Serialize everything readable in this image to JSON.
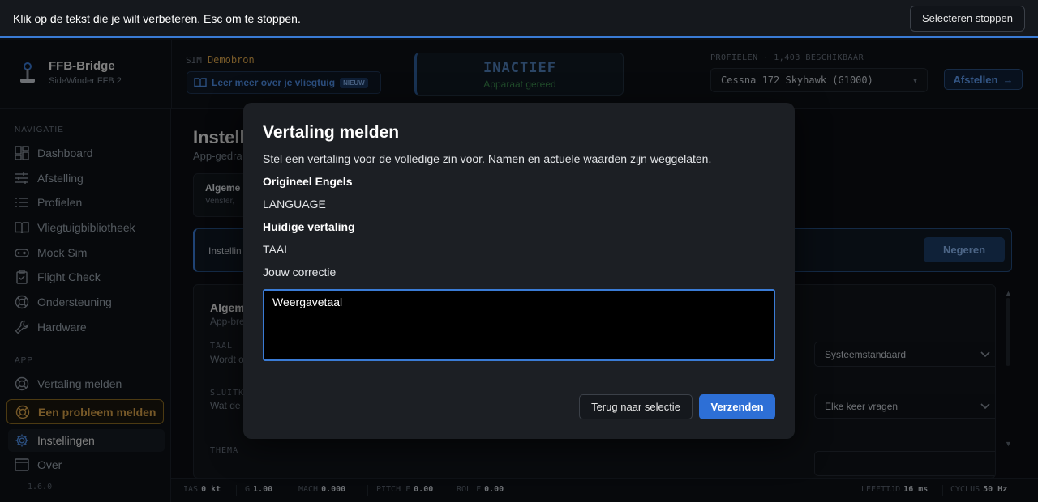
{
  "translate_bar": {
    "message": "Klik op de tekst die je wilt verbeteren. Esc om te stoppen.",
    "stop_label": "Selecteren stoppen"
  },
  "header": {
    "app_name": "FFB-Bridge",
    "device": "SideWinder FFB 2",
    "sim_label": "SIM",
    "sim_value": "Demobron",
    "learn_label": "Leer meer over je vliegtuig",
    "learn_badge": "NIEUW",
    "status_title": "INACTIEF",
    "status_sub": "Apparaat gereed",
    "profiles_label": "PROFIELEN · 1,403 BESCHIKBAAR",
    "profile_selected": "Cessna 172 Skyhawk (G1000)",
    "tune_label": "Afstellen",
    "accent": "#3a7bd5"
  },
  "sidebar": {
    "nav_label": "NAVIGATIE",
    "nav_items": [
      {
        "label": "Dashboard",
        "icon": "dashboard-icon"
      },
      {
        "label": "Afstelling",
        "icon": "sliders-icon"
      },
      {
        "label": "Profielen",
        "icon": "list-icon"
      },
      {
        "label": "Vliegtuigbibliotheek",
        "icon": "book-icon"
      },
      {
        "label": "Mock Sim",
        "icon": "gamepad-icon"
      },
      {
        "label": "Flight Check",
        "icon": "clipboard-icon"
      },
      {
        "label": "Ondersteuning",
        "icon": "lifebuoy-icon"
      },
      {
        "label": "Hardware",
        "icon": "wrench-icon"
      }
    ],
    "app_label": "APP",
    "app_items": {
      "translate": "Vertaling melden",
      "report": "Een probleem melden",
      "settings": "Instellingen",
      "about": "Over"
    },
    "version": "1.6.0"
  },
  "main": {
    "title": "Instell",
    "subtitle": "App-gedra",
    "tab_title": "Algeme",
    "tab_sub": "Venster,",
    "banner_text": "Instellin",
    "banner_button": "Negeren",
    "card_title": "Algem",
    "card_sub": "App-bre",
    "rows": [
      {
        "label": "TAAL",
        "desc": "Wordt o",
        "value": "Systeemstandaard"
      },
      {
        "label": "SLUITKI",
        "desc": "Wat de",
        "value": "Elke keer vragen"
      },
      {
        "label": "THEMA",
        "desc": "",
        "value": ""
      }
    ]
  },
  "footer": {
    "ias_label": "IAS",
    "ias_value": "0 kt",
    "g_label": "G",
    "g_value": "1.00",
    "mach_label": "MACH",
    "mach_value": "0.000",
    "pitchf_label": "PITCH F",
    "pitchf_value": "0.00",
    "rolf_label": "ROL F",
    "rolf_value": "0.00",
    "latency_label": "LEEFTIJD",
    "latency_value": "16 ms",
    "cycle_label": "CYCLUS",
    "cycle_value": "50 Hz"
  },
  "modal": {
    "title": "Vertaling melden",
    "description": "Stel een vertaling voor de volledige zin voor. Namen en actuele waarden zijn weggelaten.",
    "original_label": "Origineel Engels",
    "original_value": "LANGUAGE",
    "current_label": "Huidige vertaling",
    "current_value": "TAAL",
    "correction_label": "Jouw correctie",
    "correction_value": "Weergavetaal",
    "back_label": "Terug naar selectie",
    "send_label": "Verzenden",
    "send_color": "#2d6fd6"
  }
}
